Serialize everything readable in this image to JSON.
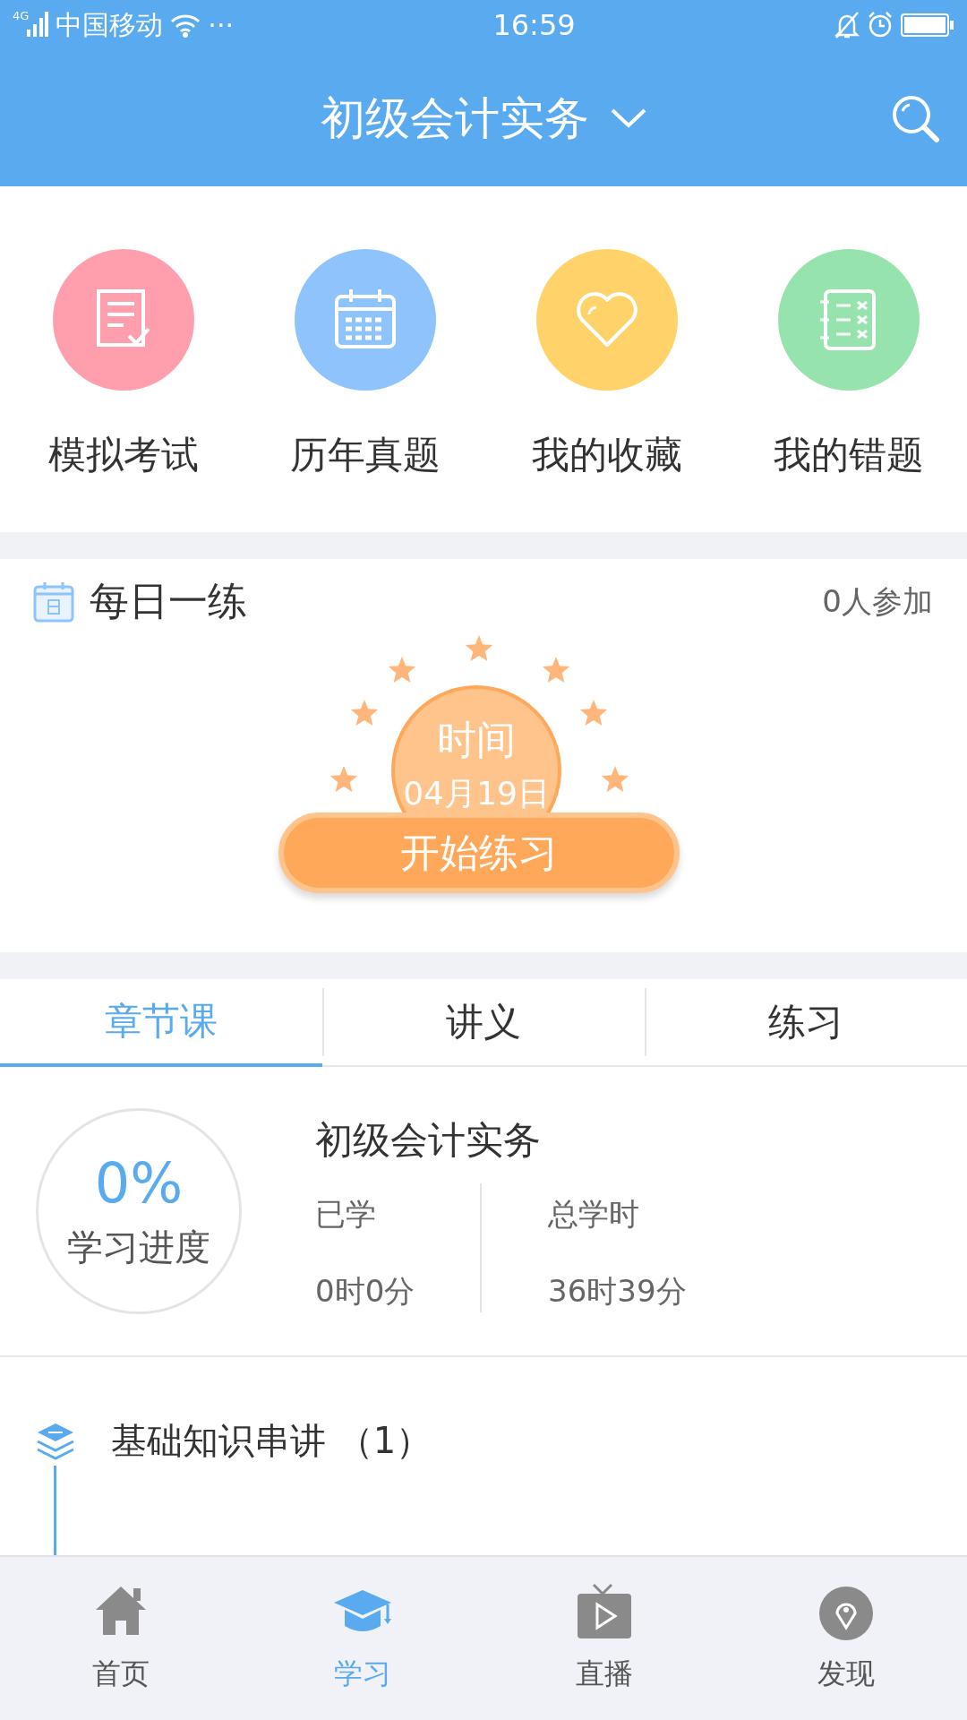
{
  "status_bar": {
    "network": "4G",
    "carrier": "中国移动",
    "more": "···",
    "time": "16:59"
  },
  "header": {
    "title": "初级会计实务"
  },
  "shortcuts": [
    {
      "label": "模拟考试",
      "kind": "exam",
      "color": "#ff9fae"
    },
    {
      "label": "历年真题",
      "kind": "calendar",
      "color": "#8ec4fb"
    },
    {
      "label": "我的收藏",
      "kind": "heart",
      "color": "#ffd26a"
    },
    {
      "label": "我的错题",
      "kind": "notebook",
      "color": "#97e3ad"
    }
  ],
  "daily": {
    "title": "每日一练",
    "participants": "0人参加",
    "badge_label": "时间",
    "date": "04月19日",
    "button": "开始练习"
  },
  "tabs": [
    {
      "label": "章节课",
      "selected": true
    },
    {
      "label": "讲义",
      "selected": false
    },
    {
      "label": "练习",
      "selected": false
    }
  ],
  "course": {
    "progress": "0%",
    "progress_label": "学习进度",
    "title": "初级会计实务",
    "stats": [
      {
        "label": "已学",
        "value": "0时0分"
      },
      {
        "label": "总学时",
        "value": "36时39分"
      }
    ]
  },
  "chapters": [
    {
      "title": "基础知识串讲 （1）"
    }
  ],
  "nav": [
    {
      "label": "首页",
      "kind": "home",
      "selected": false
    },
    {
      "label": "学习",
      "kind": "study",
      "selected": true
    },
    {
      "label": "直播",
      "kind": "live",
      "selected": false
    },
    {
      "label": "发现",
      "kind": "discover",
      "selected": false
    }
  ]
}
